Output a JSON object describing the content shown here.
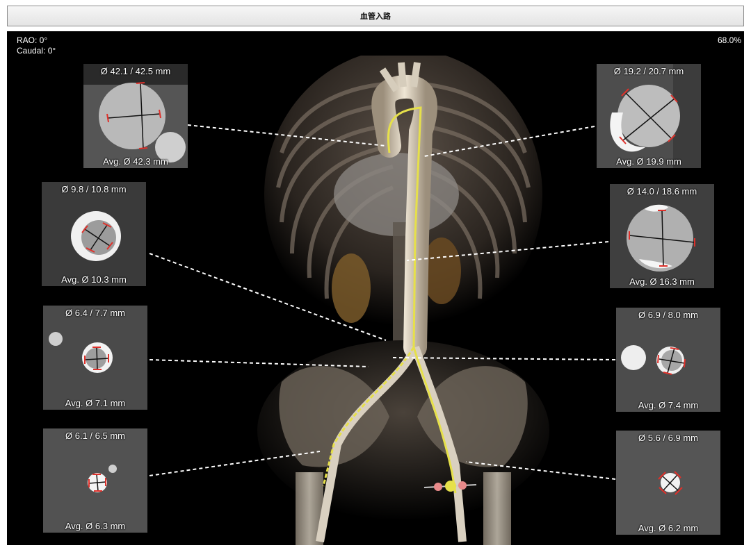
{
  "window": {
    "title": "血管入路"
  },
  "view": {
    "rao": "RAO: 0°",
    "caudal": "Caudal: 0°",
    "zoom": "68.0%"
  },
  "panels": {
    "aorta_asc": {
      "diameter": "Ø 42.1 / 42.5 mm",
      "average": "Avg. Ø 42.3 mm"
    },
    "aorta_desc": {
      "diameter": "Ø 19.2 / 20.7 mm",
      "average": "Avg. Ø 19.9 mm"
    },
    "left_upper": {
      "diameter": "Ø 9.8 / 10.8 mm",
      "average": "Avg. Ø 10.3 mm"
    },
    "right_upper": {
      "diameter": "Ø 14.0 / 18.6 mm",
      "average": "Avg. Ø 16.3 mm"
    },
    "left_mid": {
      "diameter": "Ø 6.4 / 7.7 mm",
      "average": "Avg. Ø 7.1 mm"
    },
    "right_mid": {
      "diameter": "Ø 6.9 / 8.0 mm",
      "average": "Avg. Ø 7.4 mm"
    },
    "left_low": {
      "diameter": "Ø 6.1 / 6.5 mm",
      "average": "Avg. Ø 6.3 mm"
    },
    "right_low": {
      "diameter": "Ø 5.6 / 6.9 mm",
      "average": "Avg. Ø 6.2 mm"
    }
  },
  "colors": {
    "centerline": "#e6e04a",
    "caliper_tick": "#e0302a",
    "connector": "#ffffff"
  }
}
